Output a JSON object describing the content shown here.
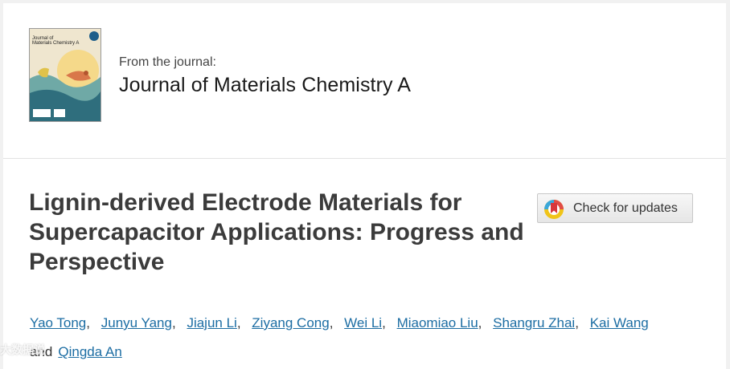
{
  "journal": {
    "from_label": "From the journal:",
    "title": "Journal of Materials Chemistry A",
    "cover_title_line1": "Journal of",
    "cover_title_line2": "Materials Chemistry A"
  },
  "article": {
    "title": "Lignin-derived Electrode Materials for Supercapacitor Applications: Progress and Perspective"
  },
  "updates_button": {
    "label": "Check for updates",
    "icon": "crossmark-icon"
  },
  "authors": {
    "list": [
      "Yao Tong",
      "Junyu Yang",
      "Jiajun Li",
      "Ziyang Cong",
      "Wei Li",
      "Miaomiao Liu",
      "Shangru Zhai",
      "Kai Wang"
    ],
    "separator": ",",
    "and_word": "and",
    "last": "Qingda An"
  },
  "watermark": {
    "text": "大数据说"
  },
  "colors": {
    "link": "#1c6da3",
    "title_text": "#3b3b3b",
    "background": "#ffffff"
  }
}
